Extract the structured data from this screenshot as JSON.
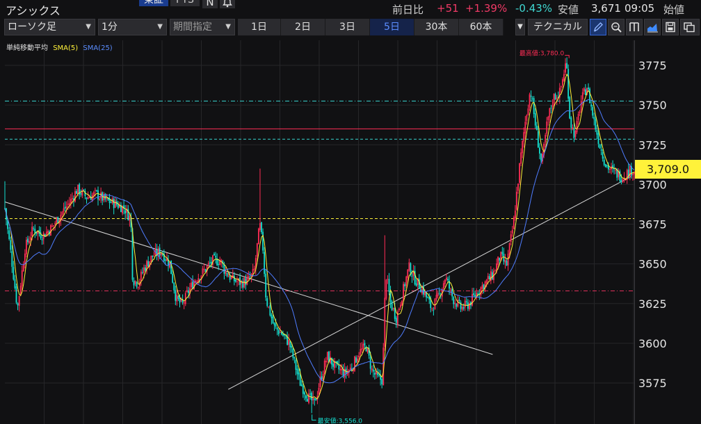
{
  "header": {
    "stock_name": "アシックス",
    "market_tab_active": "東証",
    "market_tab_other": "PTS",
    "news_button": "N",
    "change_label": "前日比",
    "change_value": "+51",
    "change_pct": "+1.39%",
    "low_pct": "-0.43%",
    "low_label": "安値",
    "low_value": "3,671",
    "time": "09:05",
    "open_label": "始値"
  },
  "toolbar": {
    "chart_type": "ローソク足",
    "interval": "1分",
    "period_placeholder": "期間指定",
    "periods": [
      "1日",
      "2日",
      "3日",
      "5日",
      "30本",
      "60本"
    ],
    "active_period": "5日",
    "technical_label": "テクニカル"
  },
  "legend": {
    "title": "単純移動平均",
    "sma5": "SMA(5)",
    "sma25": "SMA(25)"
  },
  "annotations": {
    "high_label": "最高値:3,780.0",
    "low_label": "最安値:3,556.0"
  },
  "current_price_label": "3,709.0",
  "colors": {
    "bull": "#ff2d55",
    "bear": "#14e0d0",
    "sma5": "#fff23a",
    "sma25": "#4f7dff",
    "trendline": "#d8d8d8",
    "level_red": "#ff2d55",
    "level_cyan": "#38d4d0",
    "level_yellow": "#fff23a",
    "level_crimson": "#e0305a",
    "up_text": "#f03a66",
    "down_text": "#3fd8d2"
  },
  "chart_data": {
    "type": "candlestick",
    "ylim": [
      3550,
      3790
    ],
    "yticks": [
      3575,
      3600,
      3625,
      3650,
      3675,
      3700,
      3725,
      3750,
      3775
    ],
    "current_price": 3709.0,
    "high": 3780.0,
    "low": 3556.0,
    "horizontal_levels": [
      {
        "value": 3752.5,
        "style": "dashdot",
        "color": "cyan"
      },
      {
        "value": 3735.0,
        "style": "solid",
        "color": "red"
      },
      {
        "value": 3728.5,
        "style": "dashed",
        "color": "cyan"
      },
      {
        "value": 3678.5,
        "style": "dashed",
        "color": "yellow"
      },
      {
        "value": 3633.0,
        "style": "dashdot",
        "color": "crimson"
      }
    ],
    "sessions": 5,
    "trendlines": [
      {
        "from": [
          0.0,
          3689.0
        ],
        "to": [
          0.775,
          3593.0
        ]
      },
      {
        "from": [
          0.355,
          3571.0
        ],
        "to": [
          0.995,
          3705.0
        ]
      }
    ],
    "path_keypoints": [
      [
        0.0,
        3685
      ],
      [
        0.01,
        3655
      ],
      [
        0.02,
        3622
      ],
      [
        0.032,
        3660
      ],
      [
        0.045,
        3672
      ],
      [
        0.06,
        3668
      ],
      [
        0.075,
        3673
      ],
      [
        0.09,
        3682
      ],
      [
        0.105,
        3690
      ],
      [
        0.115,
        3697
      ],
      [
        0.13,
        3692
      ],
      [
        0.145,
        3694
      ],
      [
        0.16,
        3690
      ],
      [
        0.175,
        3688
      ],
      [
        0.19,
        3685
      ],
      [
        0.2,
        3678
      ],
      [
        0.203,
        3640
      ],
      [
        0.212,
        3638
      ],
      [
        0.222,
        3648
      ],
      [
        0.235,
        3655
      ],
      [
        0.248,
        3658
      ],
      [
        0.262,
        3650
      ],
      [
        0.272,
        3628
      ],
      [
        0.282,
        3624
      ],
      [
        0.292,
        3633
      ],
      [
        0.302,
        3640
      ],
      [
        0.315,
        3645
      ],
      [
        0.33,
        3652
      ],
      [
        0.343,
        3652
      ],
      [
        0.35,
        3645
      ],
      [
        0.362,
        3640
      ],
      [
        0.376,
        3638
      ],
      [
        0.388,
        3640
      ],
      [
        0.396,
        3645
      ],
      [
        0.405,
        3675
      ],
      [
        0.41,
        3660
      ],
      [
        0.415,
        3628
      ],
      [
        0.428,
        3610
      ],
      [
        0.44,
        3606
      ],
      [
        0.452,
        3600
      ],
      [
        0.468,
        3576
      ],
      [
        0.48,
        3567
      ],
      [
        0.492,
        3562
      ],
      [
        0.502,
        3578
      ],
      [
        0.512,
        3592
      ],
      [
        0.525,
        3585
      ],
      [
        0.54,
        3581
      ],
      [
        0.552,
        3585
      ],
      [
        0.562,
        3594
      ],
      [
        0.574,
        3598
      ],
      [
        0.583,
        3583
      ],
      [
        0.592,
        3578
      ],
      [
        0.6,
        3577
      ],
      [
        0.605,
        3645
      ],
      [
        0.613,
        3625
      ],
      [
        0.622,
        3616
      ],
      [
        0.632,
        3632
      ],
      [
        0.642,
        3648
      ],
      [
        0.652,
        3640
      ],
      [
        0.665,
        3633
      ],
      [
        0.678,
        3622
      ],
      [
        0.69,
        3630
      ],
      [
        0.7,
        3642
      ],
      [
        0.712,
        3628
      ],
      [
        0.725,
        3622
      ],
      [
        0.738,
        3625
      ],
      [
        0.75,
        3632
      ],
      [
        0.763,
        3638
      ],
      [
        0.775,
        3643
      ],
      [
        0.787,
        3655
      ],
      [
        0.797,
        3649
      ],
      [
        0.808,
        3675
      ],
      [
        0.818,
        3712
      ],
      [
        0.827,
        3740
      ],
      [
        0.835,
        3760
      ],
      [
        0.845,
        3732
      ],
      [
        0.853,
        3712
      ],
      [
        0.862,
        3740
      ],
      [
        0.872,
        3755
      ],
      [
        0.882,
        3758
      ],
      [
        0.892,
        3778
      ],
      [
        0.898,
        3740
      ],
      [
        0.906,
        3730
      ],
      [
        0.915,
        3752
      ],
      [
        0.925,
        3762
      ],
      [
        0.935,
        3742
      ],
      [
        0.945,
        3725
      ],
      [
        0.955,
        3712
      ],
      [
        0.967,
        3708
      ],
      [
        0.98,
        3705
      ],
      [
        0.995,
        3709
      ]
    ]
  }
}
